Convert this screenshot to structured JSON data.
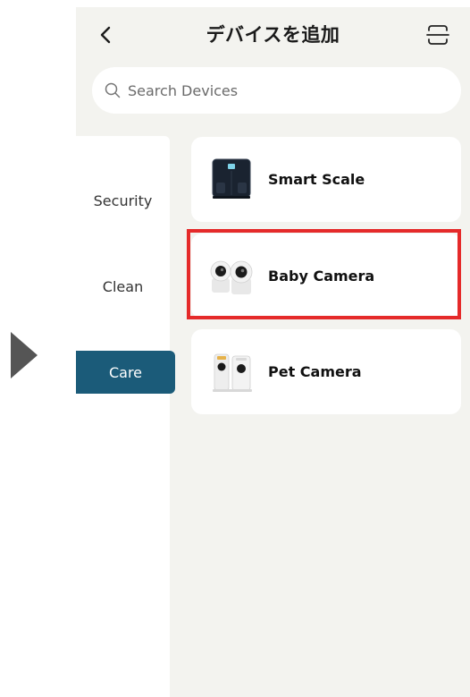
{
  "header": {
    "title": "デバイスを追加",
    "back_icon": "chevron-left-icon",
    "scan_icon": "scan-icon"
  },
  "search": {
    "placeholder": "Search Devices",
    "icon": "search-icon"
  },
  "sidebar": {
    "items": [
      {
        "label": "Security",
        "active": false
      },
      {
        "label": "Clean",
        "active": false
      },
      {
        "label": "Care",
        "active": true
      }
    ]
  },
  "devices": [
    {
      "name": "Smart Scale",
      "icon": "smart-scale-icon"
    },
    {
      "name": "Baby Camera",
      "icon": "baby-camera-icon",
      "highlighted": true
    },
    {
      "name": "Pet Camera",
      "icon": "pet-camera-icon"
    }
  ],
  "colors": {
    "accent": "#1b5b79",
    "highlight": "#e52a2a",
    "background": "#f3f3ef"
  }
}
